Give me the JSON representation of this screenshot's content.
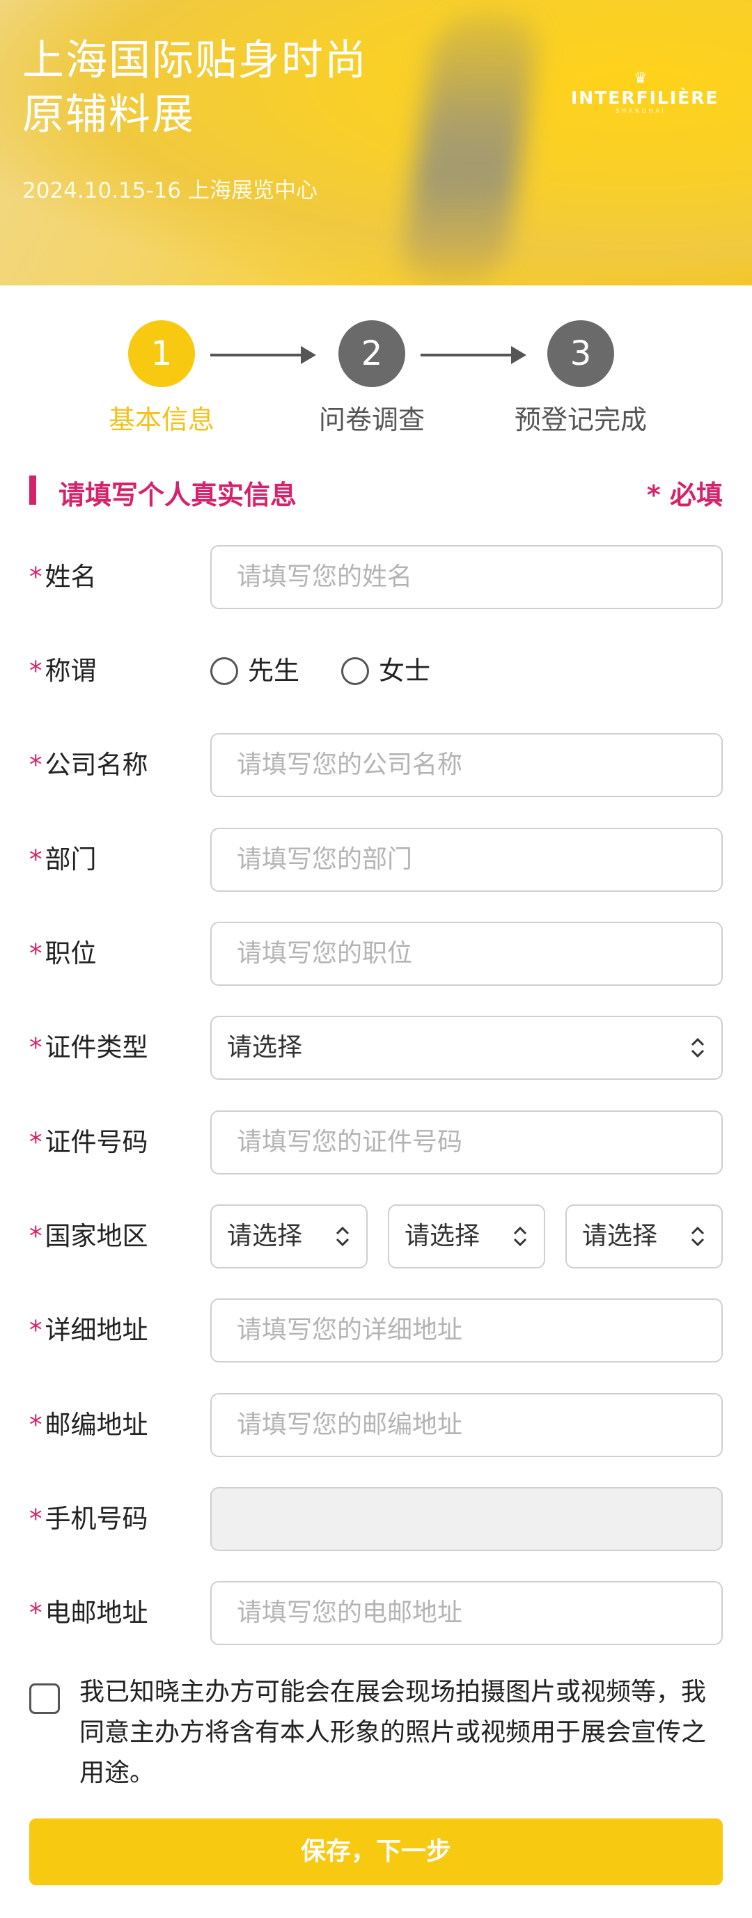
{
  "banner": {
    "title_line1": "上海国际贴身时尚",
    "title_line2": "原辅料展",
    "date_venue": "2024.10.15-16 上海展览中心",
    "brand_crown": "♛",
    "brand_name": "INTERFILIÈRE",
    "brand_sub": "SHANGHAI"
  },
  "steps": [
    {
      "number": "1",
      "label": "基本信息"
    },
    {
      "number": "2",
      "label": "问卷调查"
    },
    {
      "number": "3",
      "label": "预登记完成"
    }
  ],
  "section": {
    "title": "请填写个人真实信息",
    "required_note": "* 必填"
  },
  "form": {
    "required_mark": "*",
    "name": {
      "label": "姓名",
      "placeholder": "请填写您的姓名"
    },
    "salutation": {
      "label": "称谓",
      "options": [
        "先生",
        "女士"
      ]
    },
    "company": {
      "label": "公司名称",
      "placeholder": "请填写您的公司名称"
    },
    "department": {
      "label": "部门",
      "placeholder": "请填写您的部门"
    },
    "position": {
      "label": "职位",
      "placeholder": "请填写您的职位"
    },
    "id_type": {
      "label": "证件类型",
      "value": "请选择"
    },
    "id_number": {
      "label": "证件号码",
      "placeholder": "请填写您的证件号码"
    },
    "region": {
      "label": "国家地区",
      "selects": [
        "请选择",
        "请选择",
        "请选择"
      ]
    },
    "address": {
      "label": "详细地址",
      "placeholder": "请填写您的详细地址"
    },
    "postcode": {
      "label": "邮编地址",
      "placeholder": "请填写您的邮编地址"
    },
    "mobile": {
      "label": "手机号码",
      "value": ""
    },
    "email": {
      "label": "电邮地址",
      "placeholder": "请填写您的电邮地址"
    }
  },
  "consent": {
    "text": "我已知晓主办方可能会在展会现场拍摄图片或视频等，我同意主办方将含有本人形象的照片或视频用于展会宣传之用途。"
  },
  "submit_label": "保存，下一步",
  "colors": {
    "accent_yellow": "#f7c911",
    "brand_pink": "#d6226b",
    "step_inactive": "#6a6a6a"
  }
}
